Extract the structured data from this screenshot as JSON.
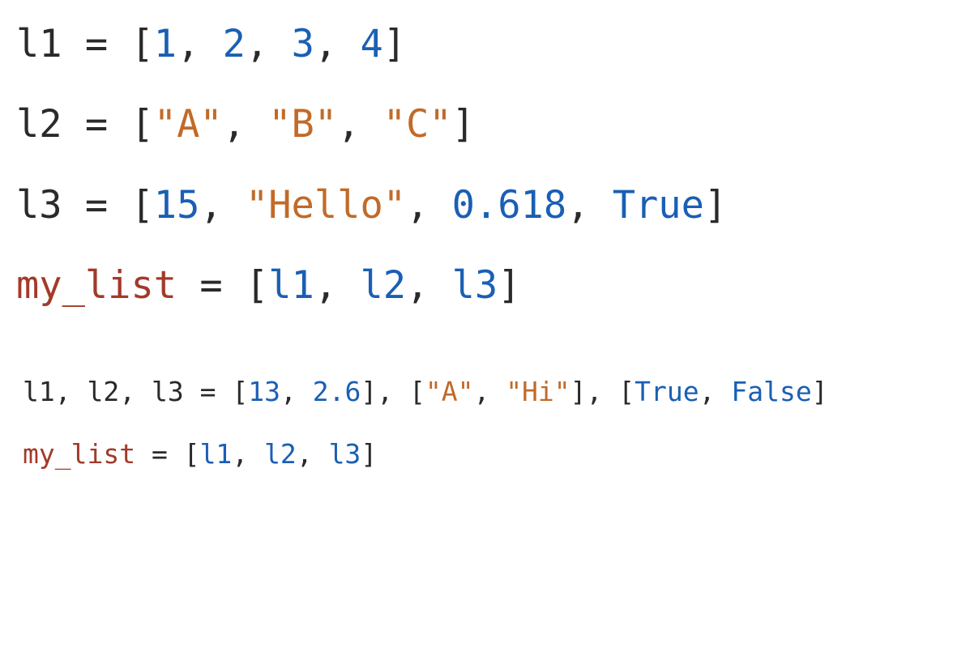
{
  "colors": {
    "number_keyword_ref": "#1a5fb4",
    "string": "#c26a28",
    "highlight_identifier": "#a33a2a",
    "default": "#2a2a2a"
  },
  "block1": {
    "lines": [
      {
        "tokens": [
          {
            "t": "l1",
            "cls": "tok-var"
          },
          {
            "t": " = [",
            "cls": "tok-punct"
          },
          {
            "t": "1",
            "cls": "tok-num"
          },
          {
            "t": ", ",
            "cls": "tok-punct"
          },
          {
            "t": "2",
            "cls": "tok-num"
          },
          {
            "t": ", ",
            "cls": "tok-punct"
          },
          {
            "t": "3",
            "cls": "tok-num"
          },
          {
            "t": ", ",
            "cls": "tok-punct"
          },
          {
            "t": "4",
            "cls": "tok-num"
          },
          {
            "t": "]",
            "cls": "tok-punct"
          }
        ]
      },
      {
        "tokens": [
          {
            "t": "l2",
            "cls": "tok-var"
          },
          {
            "t": " = [",
            "cls": "tok-punct"
          },
          {
            "t": "\"A\"",
            "cls": "tok-str"
          },
          {
            "t": ", ",
            "cls": "tok-punct"
          },
          {
            "t": "\"B\"",
            "cls": "tok-str"
          },
          {
            "t": ", ",
            "cls": "tok-punct"
          },
          {
            "t": "\"C\"",
            "cls": "tok-str"
          },
          {
            "t": "]",
            "cls": "tok-punct"
          }
        ]
      },
      {
        "tokens": [
          {
            "t": "l3",
            "cls": "tok-var"
          },
          {
            "t": " = [",
            "cls": "tok-punct"
          },
          {
            "t": "15",
            "cls": "tok-num"
          },
          {
            "t": ", ",
            "cls": "tok-punct"
          },
          {
            "t": "\"Hello\"",
            "cls": "tok-str"
          },
          {
            "t": ", ",
            "cls": "tok-punct"
          },
          {
            "t": "0.618",
            "cls": "tok-num"
          },
          {
            "t": ", ",
            "cls": "tok-punct"
          },
          {
            "t": "True",
            "cls": "tok-kw"
          },
          {
            "t": "]",
            "cls": "tok-punct"
          }
        ]
      },
      {
        "tokens": [
          {
            "t": "my_list",
            "cls": "tok-hl"
          },
          {
            "t": " = [",
            "cls": "tok-punct"
          },
          {
            "t": "l1",
            "cls": "tok-ref"
          },
          {
            "t": ", ",
            "cls": "tok-punct"
          },
          {
            "t": "l2",
            "cls": "tok-ref"
          },
          {
            "t": ", ",
            "cls": "tok-punct"
          },
          {
            "t": "l3",
            "cls": "tok-ref"
          },
          {
            "t": "]",
            "cls": "tok-punct"
          }
        ]
      }
    ]
  },
  "block2": {
    "lines": [
      {
        "tokens": [
          {
            "t": "l1",
            "cls": "tok-var"
          },
          {
            "t": ", ",
            "cls": "tok-punct"
          },
          {
            "t": "l2",
            "cls": "tok-var"
          },
          {
            "t": ", ",
            "cls": "tok-punct"
          },
          {
            "t": "l3",
            "cls": "tok-var"
          },
          {
            "t": " = [",
            "cls": "tok-punct"
          },
          {
            "t": "13",
            "cls": "tok-num"
          },
          {
            "t": ", ",
            "cls": "tok-punct"
          },
          {
            "t": "2.6",
            "cls": "tok-num"
          },
          {
            "t": "], [",
            "cls": "tok-punct"
          },
          {
            "t": "\"A\"",
            "cls": "tok-str"
          },
          {
            "t": ", ",
            "cls": "tok-punct"
          },
          {
            "t": "\"Hi\"",
            "cls": "tok-str"
          },
          {
            "t": "], [",
            "cls": "tok-punct"
          },
          {
            "t": "True",
            "cls": "tok-kw"
          },
          {
            "t": ", ",
            "cls": "tok-punct"
          },
          {
            "t": "False",
            "cls": "tok-kw"
          },
          {
            "t": "]",
            "cls": "tok-punct"
          }
        ]
      },
      {
        "tokens": [
          {
            "t": "my_list",
            "cls": "tok-hl"
          },
          {
            "t": " = [",
            "cls": "tok-punct"
          },
          {
            "t": "l1",
            "cls": "tok-ref"
          },
          {
            "t": ", ",
            "cls": "tok-punct"
          },
          {
            "t": "l2",
            "cls": "tok-ref"
          },
          {
            "t": ", ",
            "cls": "tok-punct"
          },
          {
            "t": "l3",
            "cls": "tok-ref"
          },
          {
            "t": "]",
            "cls": "tok-punct"
          }
        ]
      }
    ]
  }
}
